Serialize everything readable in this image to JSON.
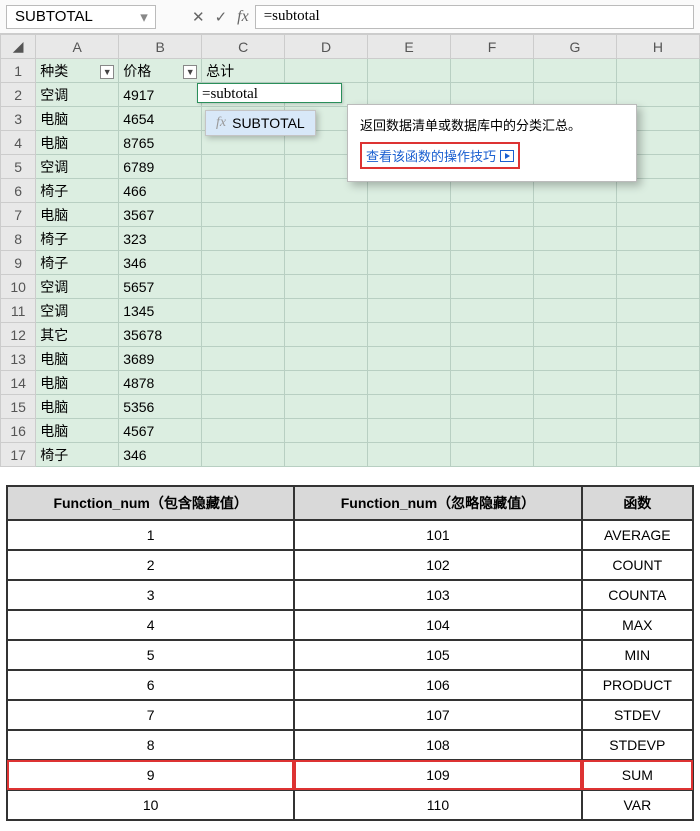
{
  "formulaBar": {
    "nameBox": "SUBTOTAL",
    "cancel": "✕",
    "confirm": "✓",
    "fx": "fx",
    "formula": "=subtotal"
  },
  "columns": [
    "A",
    "B",
    "C",
    "D",
    "E",
    "F",
    "G",
    "H"
  ],
  "headers": {
    "A": "种类",
    "B": "价格",
    "C": "总计"
  },
  "rows": [
    {
      "n": 1,
      "A": "种类",
      "B": "价格",
      "C": "总计",
      "filter": true
    },
    {
      "n": 2,
      "A": "空调",
      "B": "4917",
      "C": "=subtotal",
      "editing": true
    },
    {
      "n": 3,
      "A": "电脑",
      "B": "4654"
    },
    {
      "n": 4,
      "A": "电脑",
      "B": "8765"
    },
    {
      "n": 5,
      "A": "空调",
      "B": "6789"
    },
    {
      "n": 6,
      "A": "椅子",
      "B": "466"
    },
    {
      "n": 7,
      "A": "电脑",
      "B": "3567"
    },
    {
      "n": 8,
      "A": "椅子",
      "B": "323"
    },
    {
      "n": 9,
      "A": "椅子",
      "B": "346"
    },
    {
      "n": 10,
      "A": "空调",
      "B": "5657"
    },
    {
      "n": 11,
      "A": "空调",
      "B": "1345"
    },
    {
      "n": 12,
      "A": "其它",
      "B": "35678"
    },
    {
      "n": 13,
      "A": "电脑",
      "B": "3689"
    },
    {
      "n": 14,
      "A": "电脑",
      "B": "4878"
    },
    {
      "n": 15,
      "A": "电脑",
      "B": "5356"
    },
    {
      "n": 16,
      "A": "电脑",
      "B": "4567"
    },
    {
      "n": 17,
      "A": "椅子",
      "B": "346"
    }
  ],
  "suggest": {
    "fxLabel": "fx",
    "name": "SUBTOTAL"
  },
  "tooltip": {
    "desc": "返回数据清单或数据库中的分类汇总。",
    "link": "查看该函数的操作技巧"
  },
  "refTable": {
    "headers": [
      "Function_num（包含隐藏值）",
      "Function_num（忽略隐藏值）",
      "函数"
    ],
    "rows": [
      {
        "a": "1",
        "b": "101",
        "c": "AVERAGE"
      },
      {
        "a": "2",
        "b": "102",
        "c": "COUNT"
      },
      {
        "a": "3",
        "b": "103",
        "c": "COUNTA"
      },
      {
        "a": "4",
        "b": "104",
        "c": "MAX"
      },
      {
        "a": "5",
        "b": "105",
        "c": "MIN"
      },
      {
        "a": "6",
        "b": "106",
        "c": "PRODUCT"
      },
      {
        "a": "7",
        "b": "107",
        "c": "STDEV"
      },
      {
        "a": "8",
        "b": "108",
        "c": "STDEVP"
      },
      {
        "a": "9",
        "b": "109",
        "c": "SUM",
        "hl": true
      },
      {
        "a": "10",
        "b": "110",
        "c": "VAR"
      }
    ]
  },
  "chart_data": {
    "type": "table",
    "title": "SUBTOTAL function_num reference",
    "columns": [
      "Function_num (包含隐藏值)",
      "Function_num (忽略隐藏值)",
      "函数"
    ],
    "rows": [
      [
        1,
        101,
        "AVERAGE"
      ],
      [
        2,
        102,
        "COUNT"
      ],
      [
        3,
        103,
        "COUNTA"
      ],
      [
        4,
        104,
        "MAX"
      ],
      [
        5,
        105,
        "MIN"
      ],
      [
        6,
        106,
        "PRODUCT"
      ],
      [
        7,
        107,
        "STDEV"
      ],
      [
        8,
        108,
        "STDEVP"
      ],
      [
        9,
        109,
        "SUM"
      ],
      [
        10,
        110,
        "VAR"
      ]
    ]
  }
}
